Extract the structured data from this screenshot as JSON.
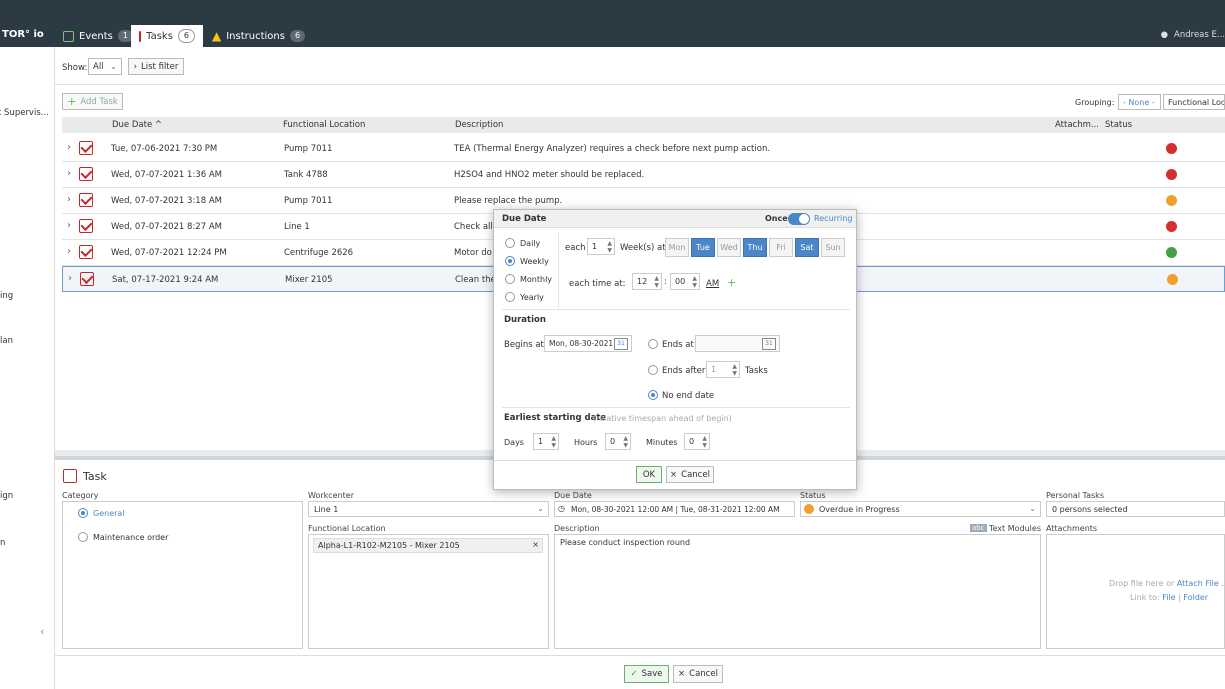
{
  "header": {
    "brand": "TOR° io",
    "tabs": [
      {
        "label": "Events",
        "count": "1"
      },
      {
        "label": "Tasks",
        "count": "6"
      },
      {
        "label": "Instructions",
        "count": "6"
      }
    ],
    "user": "Andreas E..."
  },
  "leftnav": [
    "t Supervis...",
    "ing",
    "lan",
    "ign",
    "n"
  ],
  "filters": {
    "show_label": "Show:",
    "show_value": "All",
    "list_filter": "List filter",
    "add_task": "Add Task",
    "grouping_label": "Grouping:",
    "grouping_value": "- None -",
    "grouping_option": "Functional Loca..."
  },
  "table": {
    "columns": [
      "Due Date ^",
      "Functional Location",
      "Description",
      "Attachm...",
      "Status"
    ],
    "rows": [
      {
        "due": "Tue, 07-06-2021 7:30 PM",
        "loc": "Pump 7011",
        "desc": "TEA (Thermal Energy Analyzer) requires a check before next pump action.",
        "status": "#d32f2f"
      },
      {
        "due": "Wed, 07-07-2021 1:36 AM",
        "loc": "Tank 4788",
        "desc": "H2SO4 and HNO2 meter should be replaced.",
        "status": "#d32f2f"
      },
      {
        "due": "Wed, 07-07-2021 3:18 AM",
        "loc": "Pump 7011",
        "desc": "Please replace the pump.",
        "status": "#f0a030"
      },
      {
        "due": "Wed, 07-07-2021 8:27 AM",
        "loc": "Line 1",
        "desc": "Check all",
        "status": "#d32f2f"
      },
      {
        "due": "Wed, 07-07-2021 12:24 PM",
        "loc": "Centrifuge 2626",
        "desc": "Motor do",
        "status": "#43a047"
      },
      {
        "due": "Sat, 07-17-2021 9:24 AM",
        "loc": "Mixer 2105",
        "desc": "Clean the",
        "status": "#f0a030"
      }
    ]
  },
  "dialog": {
    "title": "Due Date",
    "once": "Once",
    "recurring": "Recurring",
    "freq": [
      "Daily",
      "Weekly",
      "Monthly",
      "Yearly"
    ],
    "each": "each",
    "each_value": "1",
    "weeks_at": "Week(s) at",
    "days": [
      {
        "label": "Mon",
        "on": false
      },
      {
        "label": "Tue",
        "on": true
      },
      {
        "label": "Wed",
        "on": false
      },
      {
        "label": "Thu",
        "on": true
      },
      {
        "label": "Fri",
        "on": false
      },
      {
        "label": "Sat",
        "on": true
      },
      {
        "label": "Sun",
        "on": false
      }
    ],
    "each_time_at": "each time at:",
    "hour": "12",
    "colon": ":",
    "minute": "00",
    "ampm": "AM",
    "plus": "+",
    "duration": "Duration",
    "begins_at": "Begins at",
    "begins_value": "Mon, 08-30-2021",
    "ends_at": "Ends at",
    "ends_after": "Ends after",
    "ends_after_value": "1",
    "tasks": "Tasks",
    "no_end": "No end date",
    "earliest": "Earliest starting date",
    "earliest_hint": "(relative timespan ahead of begin)",
    "days_lbl": "Days",
    "days_val": "1",
    "hours_lbl": "Hours",
    "hours_val": "0",
    "minutes_lbl": "Minutes",
    "minutes_val": "0",
    "ok": "OK",
    "cancel": "Cancel",
    "cal": "31"
  },
  "detail": {
    "title": "Task",
    "category_label": "Category",
    "cat_general": "General",
    "cat_maint": "Maintenance order",
    "workcenter_label": "Workcenter",
    "workcenter_value": "Line 1",
    "func_loc_label": "Functional Location",
    "func_loc_value": "Alpha-L1-R102-M2105 - Mixer 2105",
    "due_label": "Due Date",
    "due_value": "Mon, 08-30-2021 12:00 AM | Tue, 08-31-2021 12:00 AM",
    "status_label": "Status",
    "status_value": "Overdue in Progress",
    "personal_label": "Personal Tasks",
    "personal_value": "0 persons selected",
    "desc_label": "Description",
    "desc_value": "Please conduct inspection round",
    "text_modules": "Text Modules",
    "abc": "abc",
    "attach_label": "Attachments",
    "drop": "Drop file here",
    "or": "or",
    "attach_file": "Attach File ...",
    "link_to": "Link to:",
    "file": "File",
    "pipe": "|",
    "folder": "Folder",
    "save": "Save",
    "cancel": "Cancel"
  }
}
